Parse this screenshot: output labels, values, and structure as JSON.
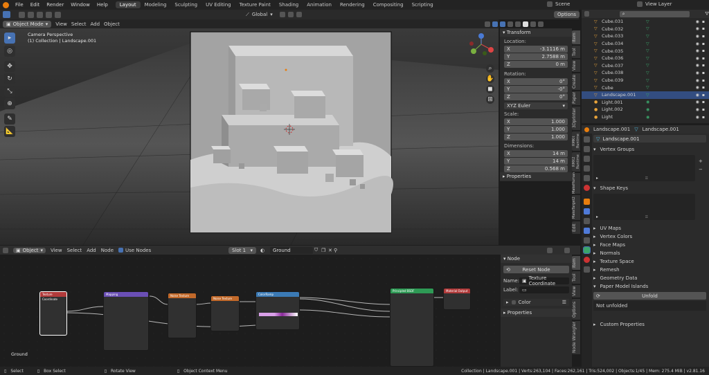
{
  "menu": [
    "File",
    "Edit",
    "Render",
    "Window",
    "Help"
  ],
  "workspaces": [
    "Layout",
    "Modeling",
    "Sculpting",
    "UV Editing",
    "Texture Paint",
    "Shading",
    "Animation",
    "Rendering",
    "Compositing",
    "Scripting"
  ],
  "active_workspace": "Layout",
  "scene_label": "Scene",
  "view_layer_label": "View Layer",
  "viewport": {
    "mode": "Object Mode",
    "menus": [
      "View",
      "Select",
      "Add",
      "Object"
    ],
    "transform_orientation": "Global",
    "options": "Options",
    "overlay_line1": "Camera Perspective",
    "overlay_line2": "(1) Collection | Landscape.001"
  },
  "npanel": {
    "header": "Transform",
    "location_label": "Location:",
    "location": [
      {
        "axis": "X",
        "value": "-3.1116 m"
      },
      {
        "axis": "Y",
        "value": "2.7588 m"
      },
      {
        "axis": "Z",
        "value": "0 m"
      }
    ],
    "rotation_label": "Rotation:",
    "rotation": [
      {
        "axis": "X",
        "value": "0°"
      },
      {
        "axis": "Y",
        "value": "-0°"
      },
      {
        "axis": "Z",
        "value": "0°"
      }
    ],
    "rotation_mode": "XYZ Euler",
    "scale_label": "Scale:",
    "scale": [
      {
        "axis": "X",
        "value": "1.000"
      },
      {
        "axis": "Y",
        "value": "1.000"
      },
      {
        "axis": "Z",
        "value": "1.000"
      }
    ],
    "dimensions_label": "Dimensions:",
    "dimensions": [
      {
        "axis": "X",
        "value": "14 m"
      },
      {
        "axis": "Y",
        "value": "14 m"
      },
      {
        "axis": "Z",
        "value": "0.568 m"
      }
    ],
    "properties": "Properties",
    "tabs": [
      "Item",
      "Tool",
      "View",
      "Create",
      "Paper",
      "3Dprinter",
      "RMKit Runtime",
      "RMX2 Runtime",
      "MakeHuman",
      "MakeTarget2",
      "Edit"
    ]
  },
  "outliner": {
    "items": [
      {
        "name": "Cube.031",
        "type": "mesh"
      },
      {
        "name": "Cube.032",
        "type": "mesh"
      },
      {
        "name": "Cube.033",
        "type": "mesh"
      },
      {
        "name": "Cube.034",
        "type": "mesh"
      },
      {
        "name": "Cube.035",
        "type": "mesh"
      },
      {
        "name": "Cube.036",
        "type": "mesh"
      },
      {
        "name": "Cube.037",
        "type": "mesh"
      },
      {
        "name": "Cube.038",
        "type": "mesh"
      },
      {
        "name": "Cube.039",
        "type": "mesh"
      },
      {
        "name": "Cube",
        "type": "mesh"
      },
      {
        "name": "Landscape.001",
        "type": "mesh",
        "selected": true
      },
      {
        "name": "Light.001",
        "type": "light"
      },
      {
        "name": "Light.002",
        "type": "light"
      },
      {
        "name": "Light",
        "type": "light"
      }
    ]
  },
  "properties": {
    "object_name": "Landscape.001",
    "data_name": "Landscape.001",
    "mesh_field": "Landscape.001",
    "sections": [
      "Vertex Groups",
      "Shape Keys",
      "UV Maps",
      "Vertex Colors",
      "Face Maps",
      "Normals",
      "Texture Space",
      "Remesh",
      "Geometry Data",
      "Paper Model Islands"
    ],
    "unfold_button": "Unfold",
    "not_unfolded": "Not unfolded",
    "custom_properties": "Custom Properties"
  },
  "node_editor": {
    "type": "Object",
    "menus": [
      "View",
      "Select",
      "Add",
      "Node"
    ],
    "use_nodes": "Use Nodes",
    "slot": "Slot 1",
    "material": "Ground",
    "material_label": "Ground",
    "panel_header": "Node",
    "reset_node": "Reset Node",
    "name_label": "Name:",
    "name_value": "Texture Coordinate",
    "label_label": "Label:",
    "color_label": "Color",
    "properties_label": "Properties",
    "tabs": [
      "Item",
      "Tool",
      "View",
      "Options",
      "Node Wrangler"
    ],
    "nodes": [
      {
        "title": "Texture Coordinate",
        "color": "#b13b3b"
      },
      {
        "title": "Mapping",
        "color": "#6a4fb5"
      },
      {
        "title": "Noise Texture",
        "color": "#c2692a"
      },
      {
        "title": "Noise Texture",
        "color": "#c2692a"
      },
      {
        "title": "ColorRamp",
        "color": "#3b7ab5"
      },
      {
        "title": "Principled BSDF",
        "color": "#2e9a55"
      },
      {
        "title": "Material Output",
        "color": "#b13b3b"
      }
    ]
  },
  "status": {
    "select": "Select",
    "box_select": "Box Select",
    "rotate_view": "Rotate View",
    "context_menu": "Object Context Menu",
    "stats": "Collection | Landscape.001 | Verts:263,104 | Faces:262,161 | Tris:524,002 | Objects:1/45 | Mem: 275.4 MiB | v2.81.16"
  }
}
